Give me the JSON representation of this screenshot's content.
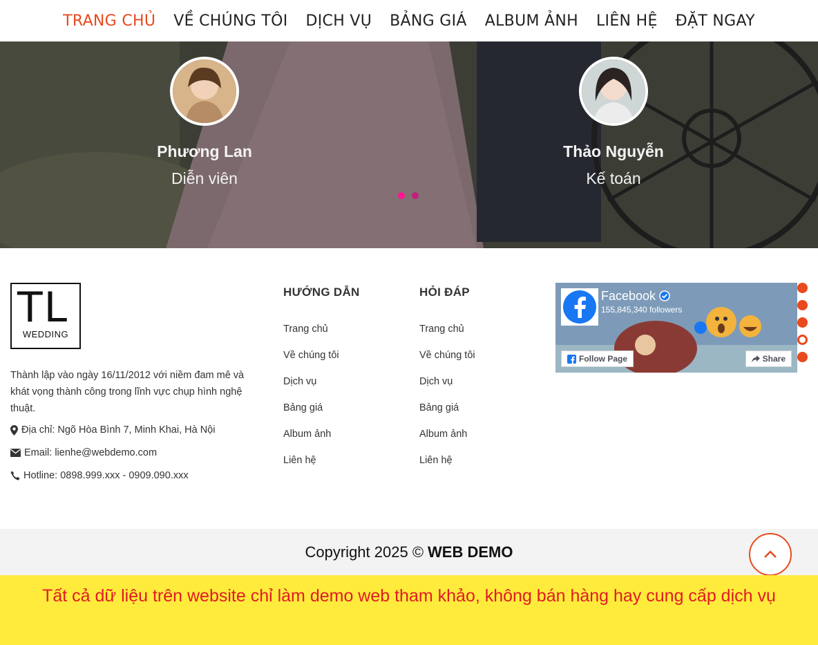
{
  "nav": {
    "items": [
      "TRANG CHỦ",
      "VỀ CHÚNG TÔI",
      "DỊCH VỤ",
      "BẢNG GIÁ",
      "ALBUM ẢNH",
      "LIÊN HỆ",
      "ĐẶT NGAY"
    ],
    "active_index": 0
  },
  "testimonials": [
    {
      "name": "Phương Lan",
      "role": "Diễn viên"
    },
    {
      "name": "Thảo Nguyễn",
      "role": "Kế toán"
    }
  ],
  "carousel": {
    "dot_count": 2,
    "active": 0
  },
  "footer": {
    "logo": {
      "main": "TL",
      "sub": "WEDDING"
    },
    "about": "Thành lập vào ngày 16/11/2012 với niềm đam mê và khát vọng thành công trong lĩnh vực chụp hình nghệ thuật.",
    "address": "Địa chỉ: Ngõ Hòa Bình 7, Minh Khai, Hà Nội",
    "email": "Email: lienhe@webdemo.com",
    "hotline": "Hotline: 0898.999.xxx - 0909.090.xxx",
    "col1": {
      "title": "HƯỚNG DẪN",
      "links": [
        "Trang chủ",
        "Về chúng tôi",
        "Dịch vụ",
        "Bảng giá",
        "Album ảnh",
        "Liên hệ"
      ]
    },
    "col2": {
      "title": "HỎI ĐÁP",
      "links": [
        "Trang chủ",
        "Về chúng tôi",
        "Dịch vụ",
        "Bảng giá",
        "Album ảnh",
        "Liên hệ"
      ]
    },
    "facebook": {
      "name": "Facebook",
      "followers": "155,845,340 followers",
      "follow_label": "Follow Page",
      "share_label": "Share"
    }
  },
  "copyright": {
    "text": "Copyright 2025 ©",
    "brand": "WEB DEMO"
  },
  "notice": "Tất cả dữ liệu trên website chỉ làm demo web tham khảo, không bán hàng hay cung cấp dịch vụ",
  "colors": {
    "accent": "#e8491d",
    "notice_bg": "#ffeb3b",
    "notice_text": "#e01b24"
  }
}
